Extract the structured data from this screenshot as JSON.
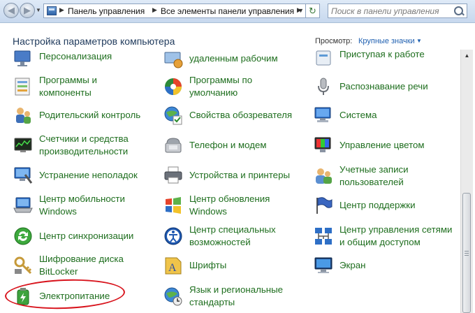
{
  "address_bar": {
    "breadcrumbs": [
      "Панель управления",
      "Все элементы панели управления"
    ],
    "search_placeholder": "Поиск в панели управления"
  },
  "header": {
    "title": "Настройка параметров компьютера",
    "view_by_label": "Просмотр:",
    "view_by_value": "Крупные значки"
  },
  "items": {
    "col1_0": {
      "line1": "Персонализация",
      "line2": "",
      "icon": "personalization-icon"
    },
    "col2_0": {
      "line1": "удаленным рабочим",
      "line2": "",
      "icon": "remoteapp-icon"
    },
    "col3_0": {
      "line1": "Приступая к работе",
      "line2": "",
      "icon": "getting-started-icon"
    },
    "col1_1": {
      "line1": "Программы и",
      "line2": "компоненты",
      "icon": "programs-icon"
    },
    "col2_1": {
      "line1": "Программы по",
      "line2": "умолчанию",
      "icon": "default-programs-icon"
    },
    "col3_1": {
      "line1": "Распознавание речи",
      "line2": "",
      "icon": "microphone-icon"
    },
    "col1_2": {
      "line1": "Родительский контроль",
      "line2": "",
      "icon": "parental-controls-icon"
    },
    "col2_2": {
      "line1": "Свойства обозревателя",
      "line2": "",
      "icon": "internet-options-icon"
    },
    "col3_2": {
      "line1": "Система",
      "line2": "",
      "icon": "system-icon"
    },
    "col1_3": {
      "line1": "Счетчики и средства",
      "line2": "производительности",
      "icon": "performance-icon"
    },
    "col2_3": {
      "line1": "Телефон и модем",
      "line2": "",
      "icon": "phone-modem-icon"
    },
    "col3_3": {
      "line1": "Управление цветом",
      "line2": "",
      "icon": "color-management-icon"
    },
    "col1_4": {
      "line1": "Устранение неполадок",
      "line2": "",
      "icon": "troubleshooting-icon"
    },
    "col2_4": {
      "line1": "Устройства и принтеры",
      "line2": "",
      "icon": "printer-icon"
    },
    "col3_4": {
      "line1": "Учетные записи",
      "line2": "пользователей",
      "icon": "user-accounts-icon"
    },
    "col1_5": {
      "line1": "Центр мобильности",
      "line2": "Windows",
      "icon": "mobility-center-icon"
    },
    "col2_5": {
      "line1": "Центр обновления",
      "line2": "Windows",
      "icon": "windows-update-icon"
    },
    "col3_5": {
      "line1": "Центр поддержки",
      "line2": "",
      "icon": "action-center-flag-icon"
    },
    "col1_6": {
      "line1": "Центр синхронизации",
      "line2": "",
      "icon": "sync-center-icon"
    },
    "col2_6": {
      "line1": "Центр специальных",
      "line2": "возможностей",
      "icon": "ease-of-access-icon"
    },
    "col3_6": {
      "line1": "Центр управления сетями",
      "line2": "и общим доступом",
      "icon": "network-center-icon"
    },
    "col1_7": {
      "line1": "Шифрование диска",
      "line2": "BitLocker",
      "icon": "bitlocker-icon"
    },
    "col2_7": {
      "line1": "Шрифты",
      "line2": "",
      "icon": "fonts-icon"
    },
    "col3_7": {
      "line1": "Экран",
      "line2": "",
      "icon": "display-icon"
    },
    "col1_8": {
      "line1": "Электропитание",
      "line2": "",
      "icon": "power-options-icon"
    },
    "col2_8": {
      "line1": "Язык и региональные",
      "line2": "стандарты",
      "icon": "region-language-icon"
    }
  },
  "colors": {
    "link_green": "#1e6e1e",
    "title_blue": "#1e395b",
    "viewby_blue": "#1e5fb0",
    "highlight_red": "#d8131c"
  }
}
